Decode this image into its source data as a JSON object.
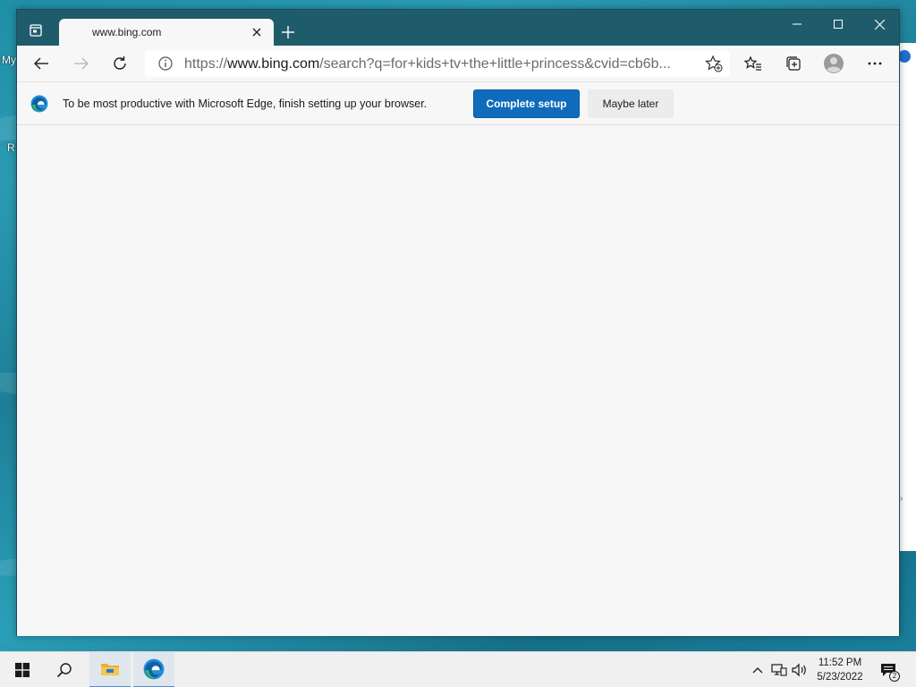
{
  "desktop": {
    "icon_labels": [
      "My",
      "R"
    ]
  },
  "browser": {
    "tab": {
      "title": "www.bing.com"
    },
    "address": {
      "scheme": "https://",
      "host": "www.bing.com",
      "path": "/search?q=for+kids+tv+the+little+princess&cvid=cb6b..."
    },
    "infobar": {
      "message": "To be most productive with Microsoft Edge, finish setting up your browser.",
      "primary_label": "Complete setup",
      "secondary_label": "Maybe later"
    }
  },
  "taskbar": {
    "clock_time": "11:52 PM",
    "clock_date": "5/23/2022",
    "notification_count": "2"
  },
  "colors": {
    "accent": "#0f6cbd",
    "titlebar": "#1f5c6b",
    "desktop": "#1f8fa6"
  },
  "icons": [
    "tab-actions-icon",
    "close-tab-icon",
    "new-tab-icon",
    "minimize-icon",
    "maximize-icon",
    "close-window-icon",
    "back-icon",
    "forward-icon",
    "refresh-icon",
    "info-icon",
    "add-favorite-icon",
    "favorites-icon",
    "collections-icon",
    "profile-icon",
    "more-icon",
    "edge-logo-icon",
    "windows-start-icon",
    "search-icon",
    "file-explorer-icon",
    "edge-taskbar-icon",
    "chevron-up-icon",
    "network-icon",
    "volume-icon",
    "notification-icon"
  ]
}
